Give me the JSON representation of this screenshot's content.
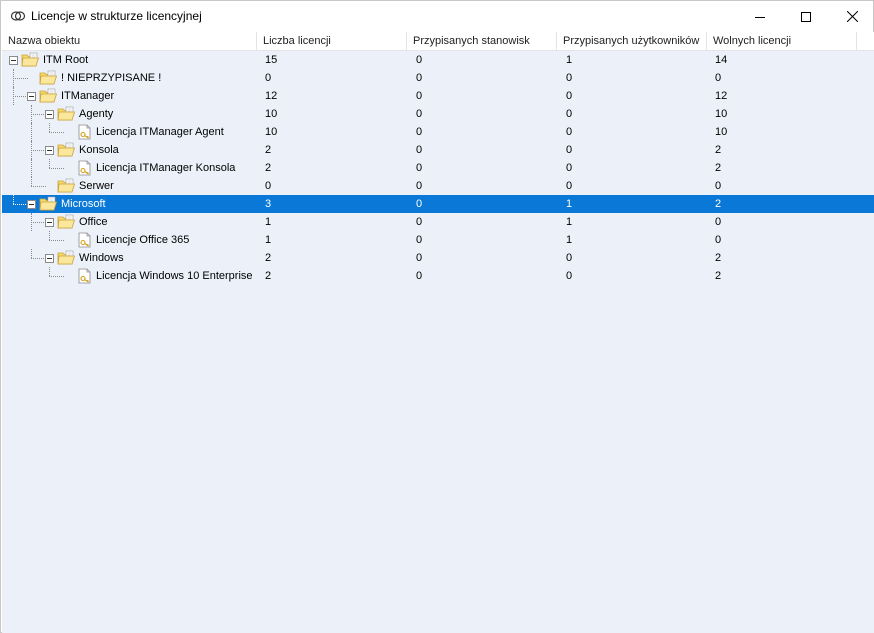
{
  "window": {
    "title": "Licencje w strukturze licencyjnej",
    "icon": "license-icon"
  },
  "columns": [
    "Nazwa obiektu",
    "Liczba licencji",
    "Przypisanych stanowisk",
    "Przypisanych użytkowników",
    "Wolnych licencji"
  ],
  "rows": [
    {
      "name": "ITM Root",
      "level": 0,
      "type": "folder",
      "expanded": true,
      "values": [
        "15",
        "0",
        "1",
        "14"
      ]
    },
    {
      "name": "! NIEPRZYPISANE !",
      "level": 1,
      "type": "folder",
      "values": [
        "0",
        "0",
        "0",
        "0"
      ]
    },
    {
      "name": "ITManager",
      "level": 1,
      "type": "folder",
      "expanded": true,
      "values": [
        "12",
        "0",
        "0",
        "12"
      ]
    },
    {
      "name": "Agenty",
      "level": 2,
      "type": "folder",
      "expanded": true,
      "values": [
        "10",
        "0",
        "0",
        "10"
      ]
    },
    {
      "name": "Licencja ITManager Agent",
      "level": 3,
      "type": "license",
      "values": [
        "10",
        "0",
        "0",
        "10"
      ]
    },
    {
      "name": "Konsola",
      "level": 2,
      "type": "folder",
      "expanded": true,
      "values": [
        "2",
        "0",
        "0",
        "2"
      ]
    },
    {
      "name": "Licencja ITManager Konsola",
      "level": 3,
      "type": "license",
      "values": [
        "2",
        "0",
        "0",
        "2"
      ]
    },
    {
      "name": "Serwer",
      "level": 2,
      "type": "folder",
      "values": [
        "0",
        "0",
        "0",
        "0"
      ]
    },
    {
      "name": "Microsoft",
      "level": 1,
      "type": "folder",
      "expanded": true,
      "selected": true,
      "values": [
        "3",
        "0",
        "1",
        "2"
      ]
    },
    {
      "name": "Office",
      "level": 2,
      "type": "folder",
      "expanded": true,
      "values": [
        "1",
        "0",
        "1",
        "0"
      ]
    },
    {
      "name": "Licencje Office 365",
      "level": 3,
      "type": "license",
      "values": [
        "1",
        "0",
        "1",
        "0"
      ]
    },
    {
      "name": "Windows",
      "level": 2,
      "type": "folder",
      "expanded": true,
      "values": [
        "2",
        "0",
        "0",
        "2"
      ]
    },
    {
      "name": "Licencja Windows 10 Enterprise",
      "level": 3,
      "type": "license",
      "values": [
        "2",
        "0",
        "0",
        "2"
      ]
    }
  ],
  "colors": {
    "selection": "#0a78d7",
    "grid_background": "#ecf1f9",
    "folder": "#f7d86a"
  }
}
